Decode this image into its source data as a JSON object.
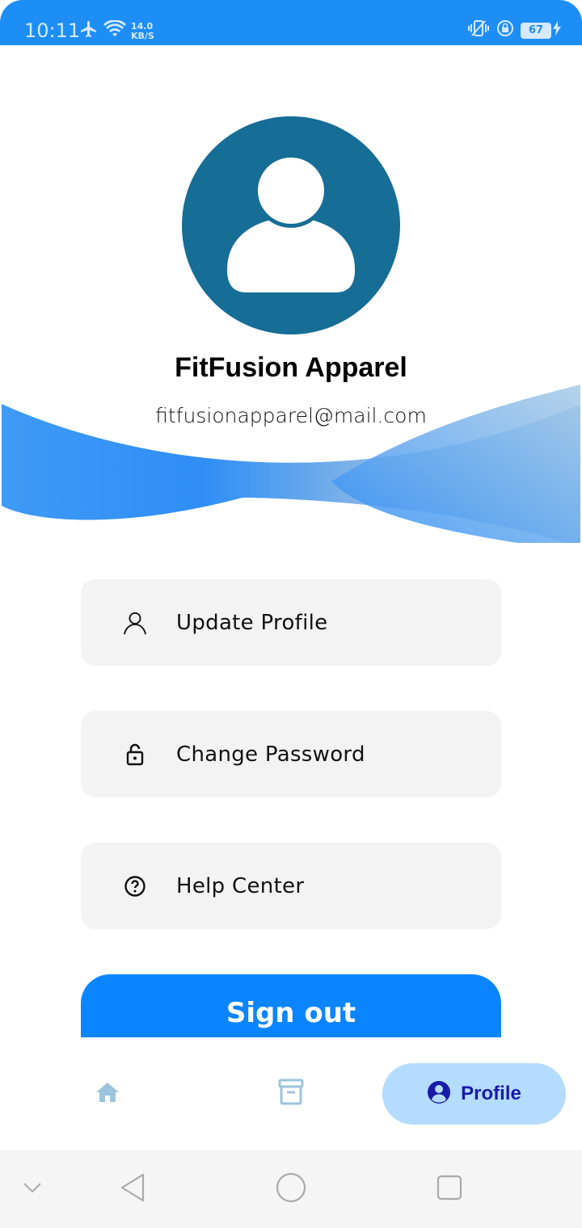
{
  "status_bar": {
    "time": "10:11",
    "speed_value": "14.0",
    "speed_unit": "KB/S",
    "battery": "67"
  },
  "profile": {
    "name": "FitFusion Apparel",
    "email": "fitfusionapparel@mail.com"
  },
  "menu": [
    {
      "label": "Update Profile",
      "icon": "person-icon"
    },
    {
      "label": "Change Password",
      "icon": "lock-icon"
    },
    {
      "label": "Help Center",
      "icon": "help-icon"
    }
  ],
  "sign_out_label": "Sign out",
  "bottom_nav": {
    "profile_label": "Profile"
  },
  "colors": {
    "status_bar": "#1e8ef7",
    "avatar": "#166d96",
    "primary_button": "#0a85ff",
    "active_nav": "#b3dcff",
    "active_nav_text": "#1a1aa8",
    "inactive_nav_icon": "#9cc4dc"
  }
}
